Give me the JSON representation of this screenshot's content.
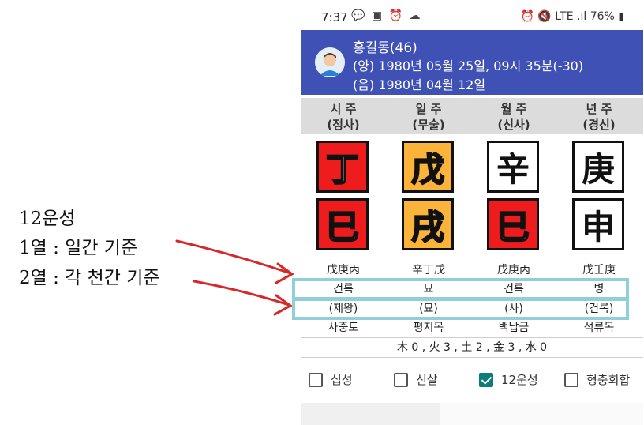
{
  "annotation": {
    "line1": "12운성",
    "line2": "1열 : 일간 기준",
    "line3": "2열 : 각 천간 기준",
    "color": "#d62828"
  },
  "status_bar": {
    "time": "7:37",
    "left_icons": "💬 ▣ ⏰ ☁",
    "right_icons": "⏰ 🔇 LTE .ıl",
    "battery": "76%"
  },
  "header": {
    "name": "홍길동(46)",
    "solar": "(양) 1980년 05월 25일, 09시 35분(-30)",
    "lunar": "(음) 1980년 04월 12일",
    "bg_color": "#3f51b5"
  },
  "pillars": [
    {
      "title": "시 주",
      "sub": "(정사)",
      "stem": "丁",
      "stem_color": "red",
      "branch": "巳",
      "branch_color": "red",
      "hidden": "戊庚丙",
      "unseong1": "건록",
      "unseong2": "(제왕)",
      "napeum": "사중토"
    },
    {
      "title": "일 주",
      "sub": "(무술)",
      "stem": "戊",
      "stem_color": "yellow",
      "branch": "戌",
      "branch_color": "yellow",
      "hidden": "辛丁戊",
      "unseong1": "묘",
      "unseong2": "(묘)",
      "napeum": "평지목"
    },
    {
      "title": "월 주",
      "sub": "(신사)",
      "stem": "辛",
      "stem_color": "white",
      "branch": "巳",
      "branch_color": "red",
      "hidden": "戊庚丙",
      "unseong1": "건록",
      "unseong2": "(사)",
      "napeum": "백납금"
    },
    {
      "title": "년 주",
      "sub": "(경신)",
      "stem": "庚",
      "stem_color": "white",
      "branch": "申",
      "branch_color": "white",
      "hidden": "戊壬庚",
      "unseong1": "병",
      "unseong2": "(건록)",
      "napeum": "석류목"
    }
  ],
  "five_elements": "木 0 , 火 3 , 土 2 , 金 3 , 水 0",
  "checkboxes": [
    {
      "label": "십성",
      "checked": false
    },
    {
      "label": "신살",
      "checked": false
    },
    {
      "label": "12운성",
      "checked": true
    },
    {
      "label": "형충회합",
      "checked": false
    }
  ],
  "colors": {
    "red": "#ee1c1c",
    "yellow": "#fbb33a",
    "highlight": "#8ecfd9",
    "check": "#0d7d78"
  }
}
